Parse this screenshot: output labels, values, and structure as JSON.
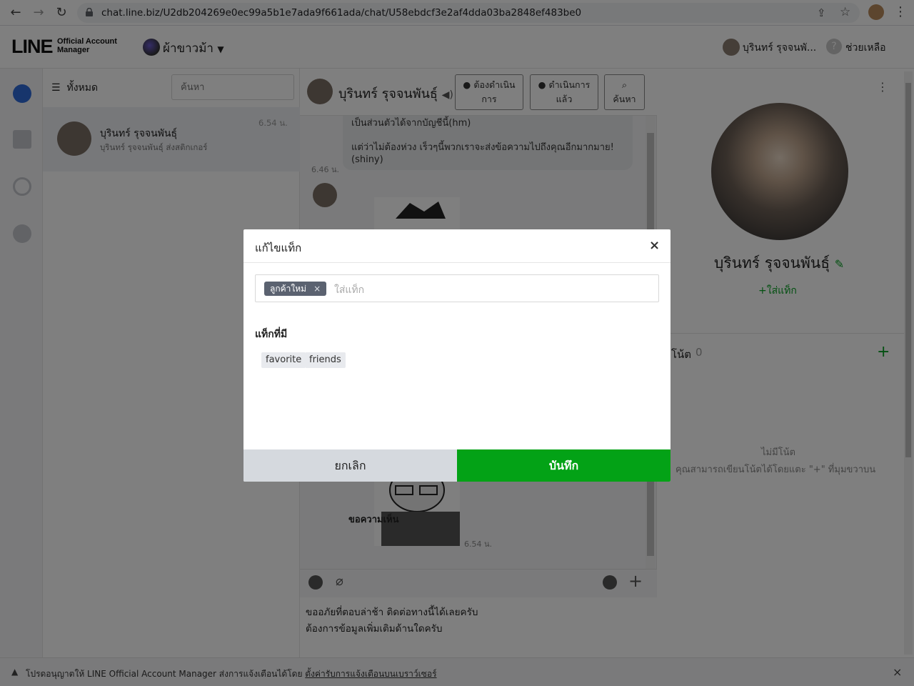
{
  "browser": {
    "url": "chat.line.biz/U2db204269e0ec99a5b1e7ada9f661ada/chat/U58ebdcf3e2af4dda03ba2848ef483be0",
    "icons": [
      "back-icon",
      "forward-icon",
      "reload-icon",
      "lock-icon",
      "share-icon",
      "star-icon",
      "profile-icon",
      "menu-icon"
    ]
  },
  "header": {
    "logo_main": "LINE",
    "logo_sub1": "Official Account",
    "logo_sub2": "Manager",
    "account_name": "ผ้าขาวม้า",
    "user_name": "บุรินทร์ รุจจนพั...",
    "help_label": "ช่วยเหลือ"
  },
  "chatlist": {
    "filter_label": "ทั้งหมด",
    "search_placeholder": "ค้นหา",
    "row": {
      "name": "บุรินทร์ รุจจนพันธุ์",
      "preview": "บุรินทร์ รุจจนพันธุ์ ส่งสติกเกอร์",
      "time": "6.54 น."
    }
  },
  "chat": {
    "name": "บุรินทร์ รุจจนพันธุ์",
    "btn_todo_line1": "ต้องดำเนิน",
    "btn_todo_line2": "การ",
    "btn_done_line1": "ดำเนินการ",
    "btn_done_line2": "แล้ว",
    "btn_search": "ค้นหา",
    "msg_line1": "เป็นส่วนตัวได้จากบัญชีนี้(hm)",
    "msg_line2": "แต่ว่าไม่ต้องห่วง เร็วๆนี้พวกเราจะส่งข้อความไปถึงคุณอีกมากมาย!",
    "msg_line3": "(shiny)",
    "msg_time": "6.46 น.",
    "sticker_caption": "ขอความเห็น",
    "sticker_time": "6.54 น.",
    "input_line1": "ขออภัยที่ตอบล่าช้า ติดต่อทางนี้ได้เลยครับ",
    "input_line2": "ต้องการข้อมูลเพิ่มเติมด้านใดครับ"
  },
  "profile": {
    "name": "บุรินทร์ รุจจนพันธุ์",
    "add_tag": "ใส่แท็ก",
    "notes_label": "โน้ต",
    "notes_count": "0",
    "empty_title": "ไม่มีโน้ต",
    "empty_hint": "คุณสามารถเขียนโน้ตได้โดยแตะ \"+\" ที่มุมขวาบน"
  },
  "bottombar": {
    "text": "โปรดอนุญาตให้ LINE Official Account Manager ส่งการแจ้งเตือนได้โดย ",
    "link": "ตั้งค่ารับการแจ้งเตือนบนเบราว์เซอร์"
  },
  "modal": {
    "title": "แก้ไขแท็ก",
    "current_tag": "ลูกค้าใหม่",
    "input_placeholder": "ใส่แท็ก",
    "available_title": "แท็กที่มี",
    "available_tags": [
      "favorite",
      "friends"
    ],
    "cancel_label": "ยกเลิก",
    "save_label": "บันทึก"
  },
  "colors": {
    "brand_green": "#03a216",
    "chip_bg": "#5b6270"
  }
}
